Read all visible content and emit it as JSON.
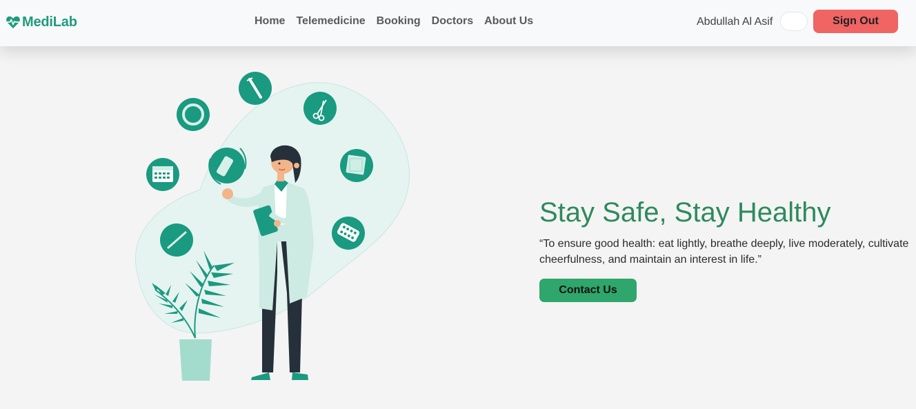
{
  "header": {
    "brand": "MediLab",
    "nav": [
      "Home",
      "Telemedicine",
      "Booking",
      "Doctors",
      "About Us"
    ],
    "user_name": "Abdullah Al Asif",
    "sign_out_label": "Sign Out"
  },
  "hero": {
    "title": "Stay Safe, Stay Healthy",
    "quote": "“To ensure good health: eat lightly, breathe deeply, live moderately, cultivate cheerfulness, and maintain an interest in life.”",
    "cta_label": "Contact Us"
  },
  "colors": {
    "brand": "#1f9b7d",
    "title": "#2e8a5c",
    "cta": "#2fa66b",
    "sign_out": "#f06464",
    "illustration_teal": "#1a9a80",
    "illustration_blob": "#e5f4f1"
  },
  "icons": [
    "heartbeat-icon",
    "syringe-icon",
    "scissors-icon",
    "ring-icon",
    "bandage-icon",
    "calendar-icon",
    "gauze-icon",
    "pills-icon",
    "thermometer-icon",
    "plant-icon"
  ]
}
